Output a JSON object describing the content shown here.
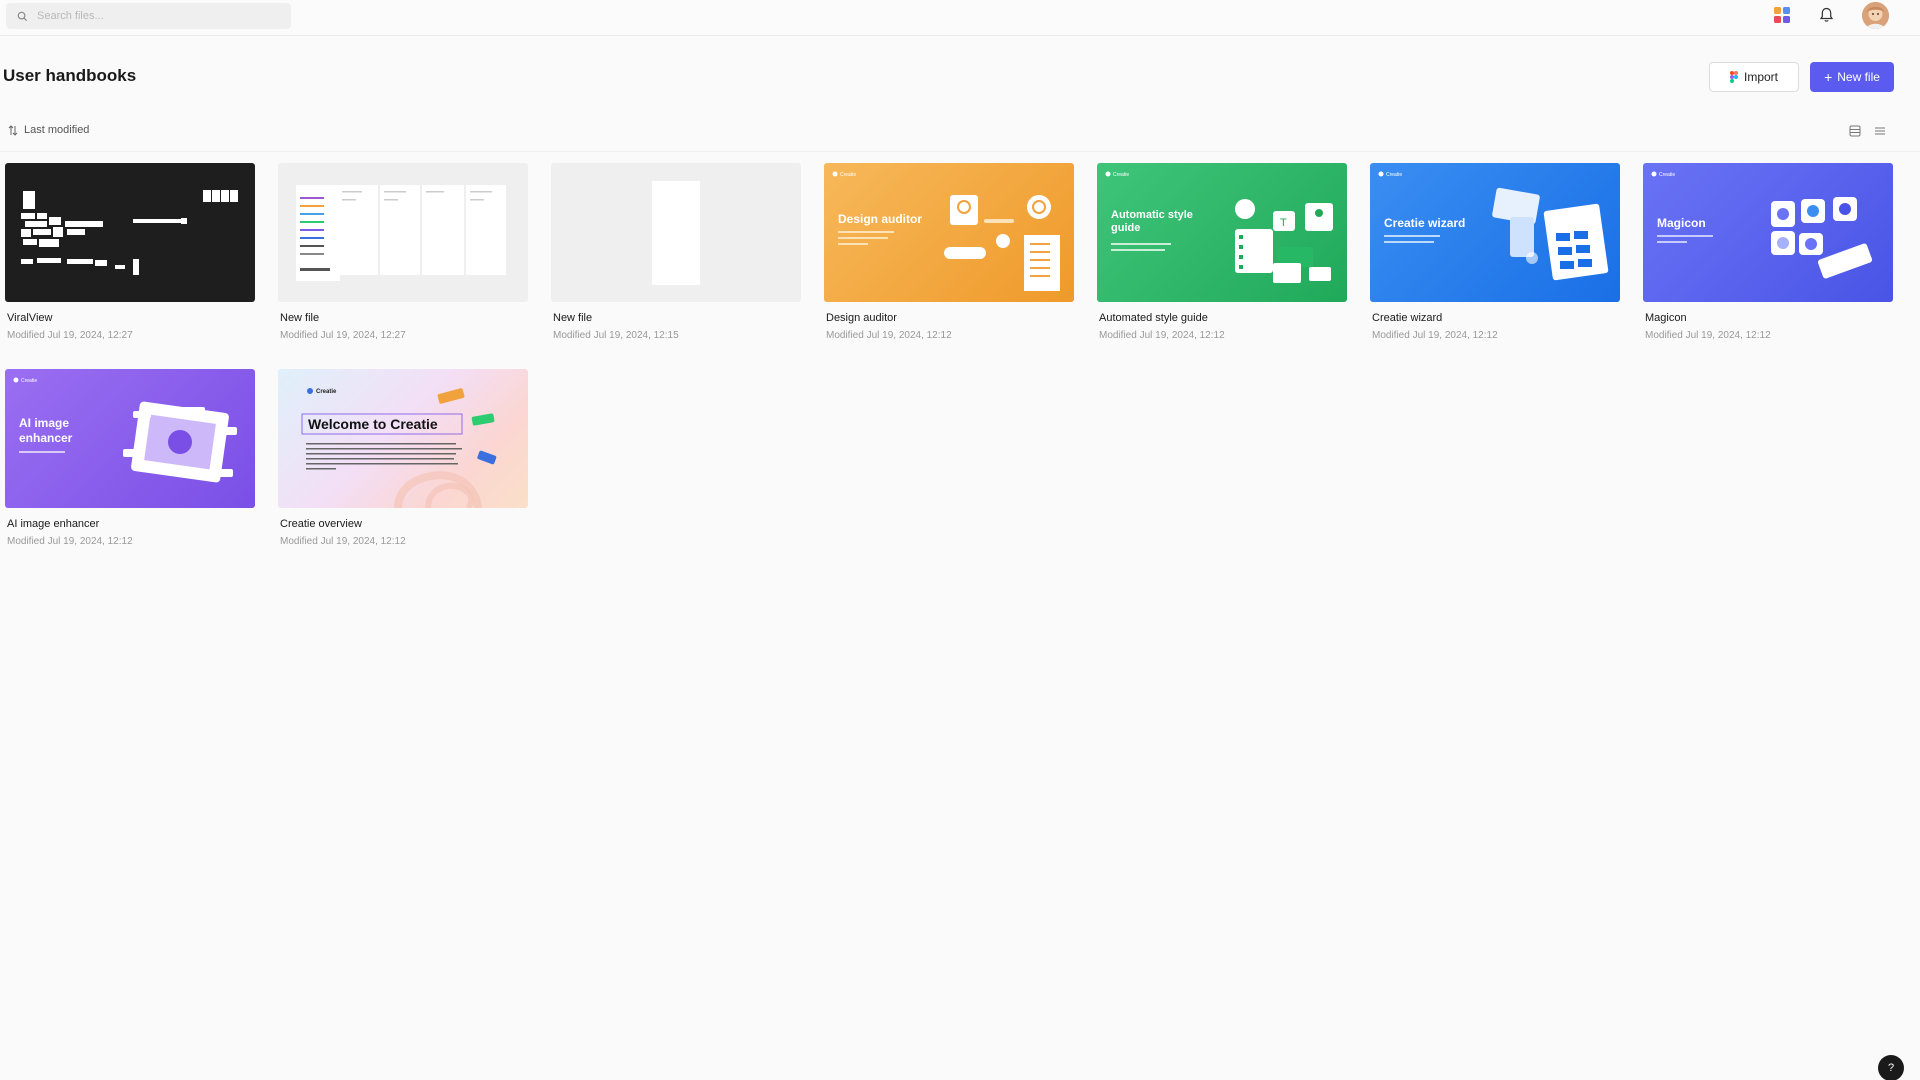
{
  "search": {
    "placeholder": "Search files..."
  },
  "topbar": {
    "icons": [
      "search-icon",
      "apps-icon",
      "bell-icon"
    ],
    "avatar": "user avatar"
  },
  "header": {
    "title": "User handbooks",
    "import_label": "Import",
    "new_file_label": "New file"
  },
  "sort": {
    "label": "Last modified"
  },
  "colors": {
    "accent": "#5b5bf0"
  },
  "files": [
    {
      "title": "ViralView",
      "modified": "Modified Jul 19, 2024, 12:27"
    },
    {
      "title": "New file",
      "modified": "Modified Jul 19, 2024, 12:27"
    },
    {
      "title": "New file",
      "modified": "Modified Jul 19, 2024, 12:15"
    },
    {
      "title": "Design auditor",
      "modified": "Modified Jul 19, 2024, 12:12",
      "thumb_title": "Design auditor",
      "thumb_brand": "Creatie"
    },
    {
      "title": "Automated style guide",
      "modified": "Modified Jul 19, 2024, 12:12",
      "thumb_title_1": "Automatic style",
      "thumb_title_2": "guide",
      "thumb_brand": "Creatie"
    },
    {
      "title": "Creatie wizard",
      "modified": "Modified Jul 19, 2024, 12:12",
      "thumb_title": "Creatie wizard",
      "thumb_brand": "Creatie"
    },
    {
      "title": "Magicon",
      "modified": "Modified Jul 19, 2024, 12:12",
      "thumb_title": "Magicon",
      "thumb_brand": "Creatie"
    },
    {
      "title": "AI image enhancer",
      "modified": "Modified Jul 19, 2024, 12:12",
      "thumb_title_1": "AI image",
      "thumb_title_2": "enhancer",
      "thumb_brand": "Creatie"
    },
    {
      "title": "Creatie overview",
      "modified": "Modified Jul 19, 2024, 12:12",
      "thumb_title": "Welcome to Creatie",
      "thumb_brand": "Creatie"
    }
  ],
  "help": {
    "label": "?"
  }
}
